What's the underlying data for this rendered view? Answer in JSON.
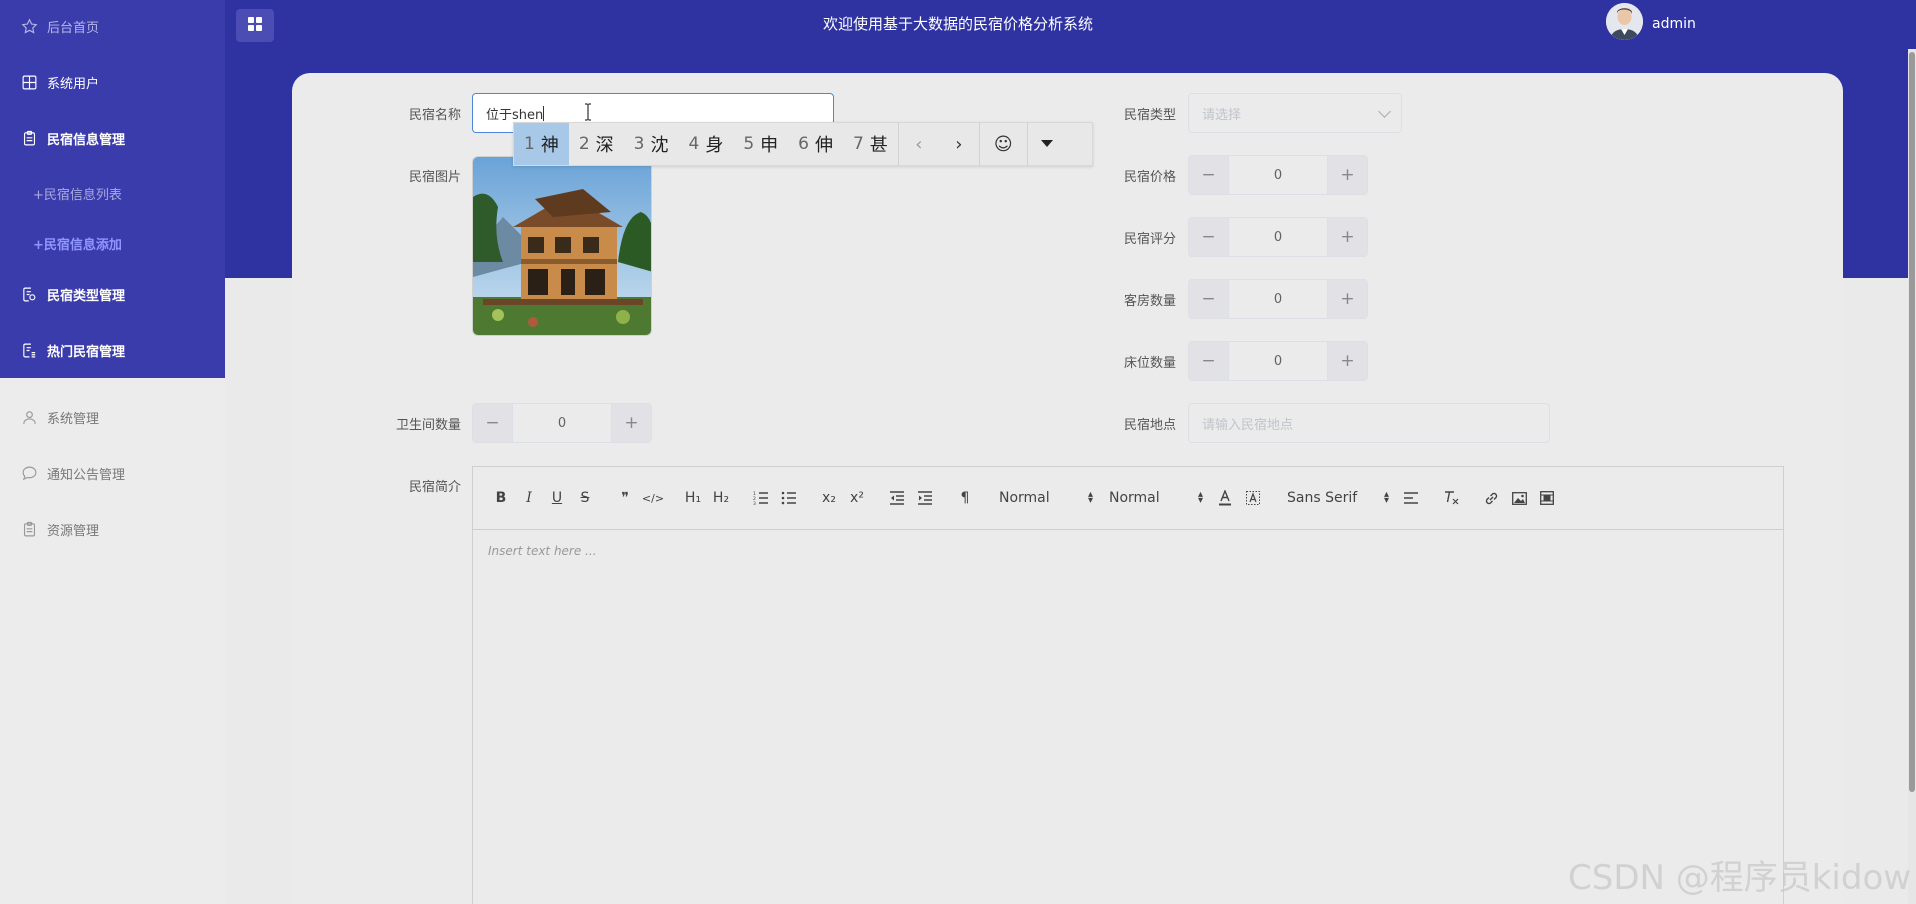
{
  "header": {
    "title": "欢迎使用基于大数据的民宿价格分析系统",
    "username": "admin",
    "colors": {
      "header_bg": "#2f32a1",
      "sidebar_active_bg": "#3b3cab"
    }
  },
  "sidebar": {
    "items": [
      {
        "label": "后台首页",
        "icon": "star-icon"
      },
      {
        "label": "系统用户",
        "icon": "grid-icon"
      },
      {
        "label": "民宿信息管理",
        "icon": "clipboard-icon"
      },
      {
        "label": "民宿类型管理",
        "icon": "doc-gear-icon"
      },
      {
        "label": "热门民宿管理",
        "icon": "doc-list-icon"
      },
      {
        "label": "系统管理",
        "icon": "user-icon"
      },
      {
        "label": "通知公告管理",
        "icon": "chat-icon"
      },
      {
        "label": "资源管理",
        "icon": "clipboard-icon"
      }
    ],
    "subitems": [
      {
        "label": "+民宿信息列表"
      },
      {
        "label": "+民宿信息添加"
      }
    ]
  },
  "form": {
    "name_label": "民宿名称",
    "name_value": "位于shen",
    "type_label": "民宿类型",
    "type_placeholder": "请选择",
    "image_label": "民宿图片",
    "price_label": "民宿价格",
    "price_value": "0",
    "score_label": "民宿评分",
    "score_value": "0",
    "rooms_label": "客房数量",
    "rooms_value": "0",
    "beds_label": "床位数量",
    "beds_value": "0",
    "bath_label": "卫生间数量",
    "bath_value": "0",
    "location_label": "民宿地点",
    "location_placeholder": "请输入民宿地点",
    "intro_label": "民宿简介",
    "stepper_minus": "−",
    "stepper_plus": "+"
  },
  "ime": {
    "candidates": [
      {
        "num": "1",
        "char": "神"
      },
      {
        "num": "2",
        "char": "深"
      },
      {
        "num": "3",
        "char": "沈"
      },
      {
        "num": "4",
        "char": "身"
      },
      {
        "num": "5",
        "char": "申"
      },
      {
        "num": "6",
        "char": "伸"
      },
      {
        "num": "7",
        "char": "甚"
      }
    ],
    "prev": "‹",
    "next": "›",
    "emoji": "☺"
  },
  "editor": {
    "header_select": "Normal",
    "size_select": "Normal",
    "font_select": "Sans Serif",
    "placeholder": "Insert text here ...",
    "buttons": {
      "bold": "B",
      "italic": "I",
      "underline": "U",
      "strike": "S",
      "quote": "❞",
      "code": "</>",
      "h1": "H₁",
      "h2": "H₂",
      "sub": "x₂",
      "sup": "x²",
      "pilcrow": "¶"
    }
  },
  "watermark": "CSDN @程序员kidow"
}
